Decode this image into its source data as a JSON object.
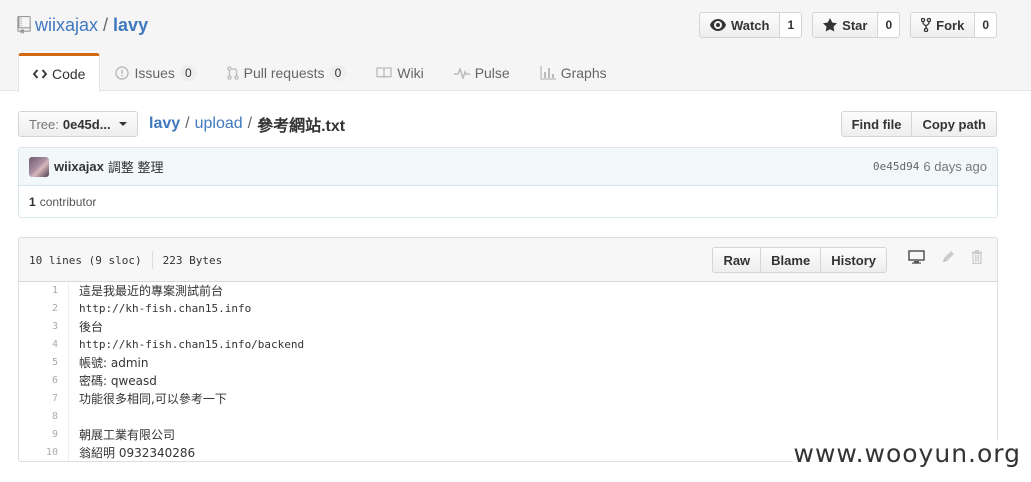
{
  "repo": {
    "owner": "wiixajax",
    "sep": "/",
    "name": "lavy"
  },
  "actions": {
    "watch": {
      "label": "Watch",
      "count": "1"
    },
    "star": {
      "label": "Star",
      "count": "0"
    },
    "fork": {
      "label": "Fork",
      "count": "0"
    }
  },
  "nav": {
    "code": {
      "label": "Code"
    },
    "issues": {
      "label": "Issues",
      "count": "0"
    },
    "pulls": {
      "label": "Pull requests",
      "count": "0"
    },
    "wiki": {
      "label": "Wiki"
    },
    "pulse": {
      "label": "Pulse"
    },
    "graphs": {
      "label": "Graphs"
    }
  },
  "file_nav": {
    "tree_label": "Tree:",
    "tree_value": "0e45d...",
    "crumbs": {
      "root": "lavy",
      "sep": "/",
      "folder": "upload",
      "file": "參考網站.txt"
    },
    "find_file": "Find file",
    "copy_path": "Copy path"
  },
  "commit": {
    "author": "wiixajax",
    "message": "調整 整理",
    "sha": "0e45d94",
    "time": "6 days ago",
    "contributors_count": "1",
    "contributors_label": "contributor"
  },
  "file": {
    "lines_info": "10 lines (9 sloc)",
    "size": "223 Bytes",
    "raw": "Raw",
    "blame": "Blame",
    "history": "History",
    "lines": [
      "這是我最近的專案測試前台",
      "http://kh-fish.chan15.info",
      "後台",
      "http://kh-fish.chan15.info/backend",
      "帳號: admin",
      "密碼: qweasd",
      "功能很多相同,可以參考一下",
      "",
      "朝展工業有限公司",
      "翁紹明 0932340286"
    ]
  },
  "watermark": "www.wooyun.org",
  "colors": {
    "link": "#4078c0",
    "accent_tab": "#d26911",
    "commit_bg": "#f2f8fa"
  }
}
